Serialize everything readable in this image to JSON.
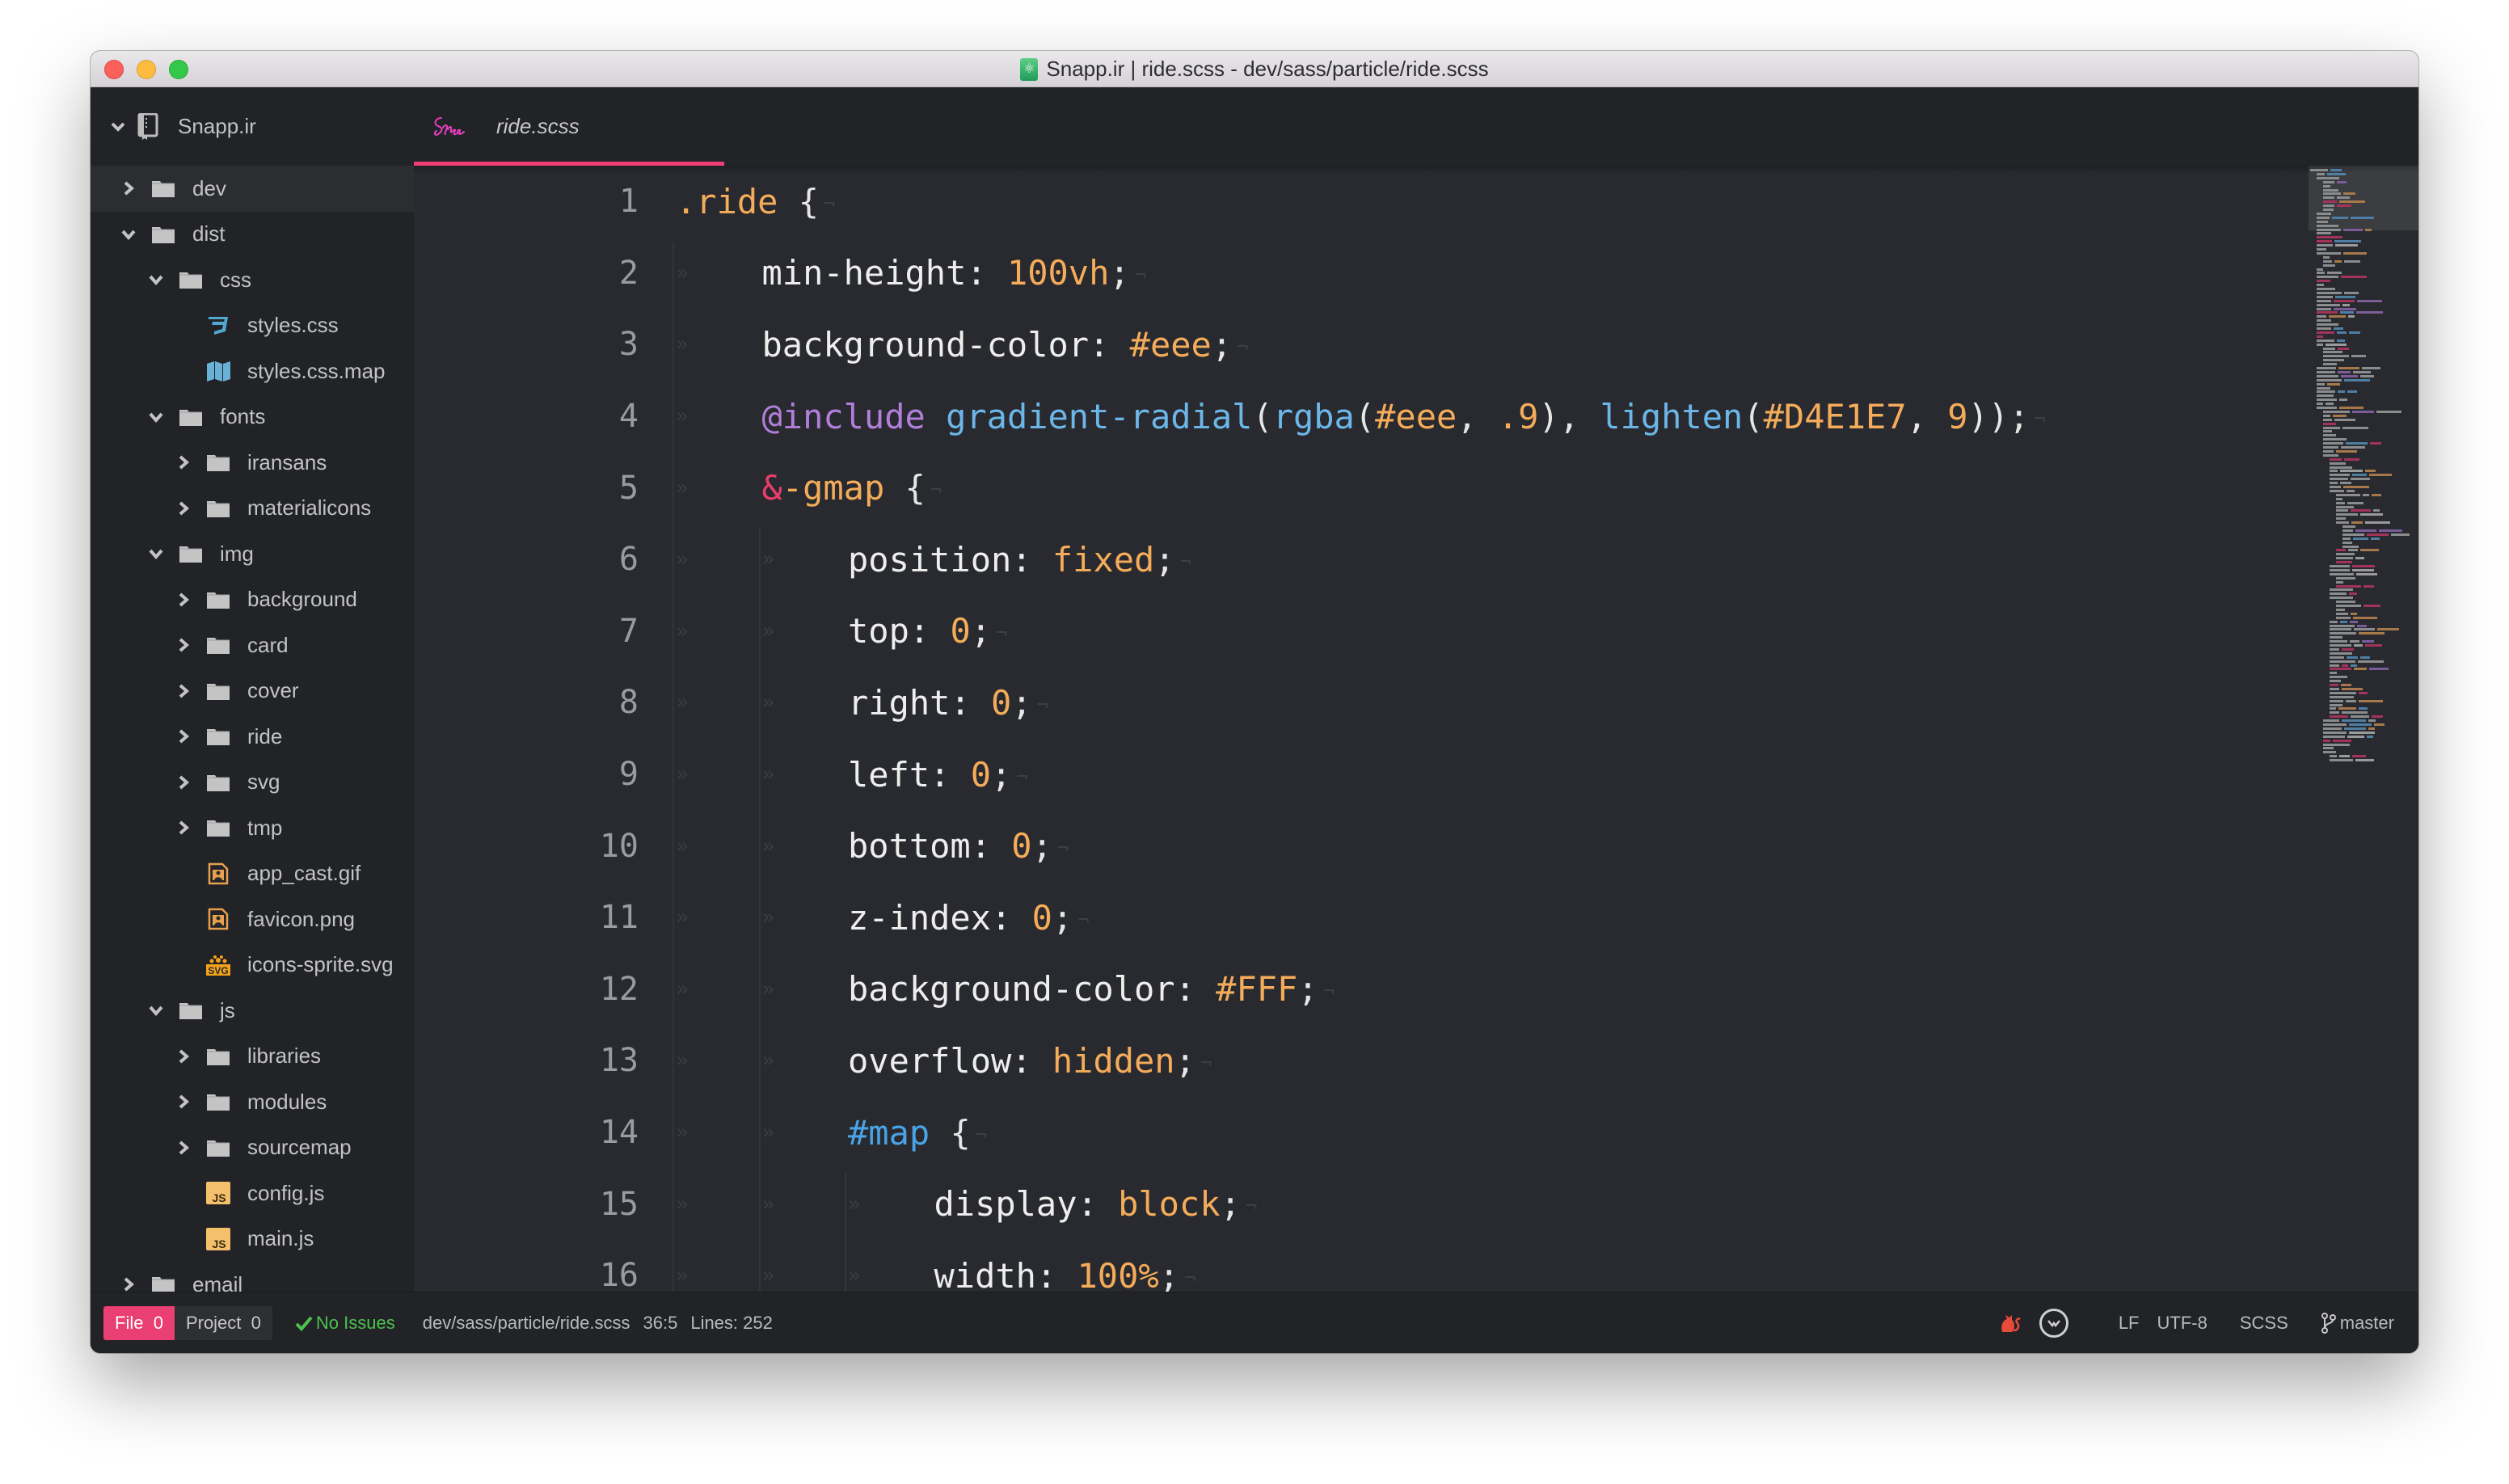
{
  "window": {
    "title": "Snapp.ir | ride.scss - dev/sass/particle/ride.scss"
  },
  "sidebar": {
    "project_name": "Snapp.ir",
    "tree": [
      {
        "label": "dev",
        "type": "folder",
        "depth": 0,
        "expanded": false,
        "selected": true
      },
      {
        "label": "dist",
        "type": "folder",
        "depth": 0,
        "expanded": true
      },
      {
        "label": "css",
        "type": "folder",
        "depth": 1,
        "expanded": true
      },
      {
        "label": "styles.css",
        "type": "file",
        "icon": "css3-icon",
        "depth": 2
      },
      {
        "label": "styles.css.map",
        "type": "file",
        "icon": "map-icon",
        "depth": 2
      },
      {
        "label": "fonts",
        "type": "folder",
        "depth": 1,
        "expanded": true
      },
      {
        "label": "iransans",
        "type": "folder",
        "depth": 2,
        "expanded": false
      },
      {
        "label": "materialicons",
        "type": "folder",
        "depth": 2,
        "expanded": false
      },
      {
        "label": "img",
        "type": "folder",
        "depth": 1,
        "expanded": true
      },
      {
        "label": "background",
        "type": "folder",
        "depth": 2,
        "expanded": false
      },
      {
        "label": "card",
        "type": "folder",
        "depth": 2,
        "expanded": false
      },
      {
        "label": "cover",
        "type": "folder",
        "depth": 2,
        "expanded": false
      },
      {
        "label": "ride",
        "type": "folder",
        "depth": 2,
        "expanded": false
      },
      {
        "label": "svg",
        "type": "folder",
        "depth": 2,
        "expanded": false
      },
      {
        "label": "tmp",
        "type": "folder",
        "depth": 2,
        "expanded": false
      },
      {
        "label": "app_cast.gif",
        "type": "file",
        "icon": "image-icon",
        "depth": 2
      },
      {
        "label": "favicon.png",
        "type": "file",
        "icon": "image-icon",
        "depth": 2
      },
      {
        "label": "icons-sprite.svg",
        "type": "file",
        "icon": "svg-icon",
        "depth": 2
      },
      {
        "label": "js",
        "type": "folder",
        "depth": 1,
        "expanded": true
      },
      {
        "label": "libraries",
        "type": "folder",
        "depth": 2,
        "expanded": false
      },
      {
        "label": "modules",
        "type": "folder",
        "depth": 2,
        "expanded": false
      },
      {
        "label": "sourcemap",
        "type": "folder",
        "depth": 2,
        "expanded": false
      },
      {
        "label": "config.js",
        "type": "file",
        "icon": "js-icon",
        "depth": 2
      },
      {
        "label": "main.js",
        "type": "file",
        "icon": "js-icon",
        "depth": 2
      },
      {
        "label": "email",
        "type": "folder",
        "depth": 0,
        "expanded": false
      }
    ]
  },
  "tabs": [
    {
      "label": "ride.scss",
      "icon": "sass-icon",
      "active": true
    }
  ],
  "colors": {
    "accent": "#ee3f74",
    "selector": "#f5ac5a",
    "value": "#f5ac5a",
    "at_rule": "#b17fd9",
    "function": "#6cb6e8",
    "ampersand": "#ea3e6a",
    "id": "#4aa3e6",
    "ok": "#4cc24e"
  },
  "editor": {
    "lines": [
      {
        "n": "1",
        "indent": 0,
        "tokens": [
          [
            "sel",
            ".ride"
          ],
          [
            "punc",
            " {"
          ]
        ]
      },
      {
        "n": "2",
        "indent": 1,
        "tokens": [
          [
            "prop",
            "min-height: "
          ],
          [
            "val",
            "100vh"
          ],
          [
            "punc",
            ";"
          ]
        ]
      },
      {
        "n": "3",
        "indent": 1,
        "tokens": [
          [
            "prop",
            "background-color: "
          ],
          [
            "val",
            "#eee"
          ],
          [
            "punc",
            ";"
          ]
        ]
      },
      {
        "n": "4",
        "indent": 1,
        "tokens": [
          [
            "at",
            "@include"
          ],
          [
            "punc",
            " "
          ],
          [
            "fn",
            "gradient-radial"
          ],
          [
            "punc",
            "("
          ],
          [
            "fn",
            "rgba"
          ],
          [
            "punc",
            "("
          ],
          [
            "val",
            "#eee"
          ],
          [
            "punc",
            ", "
          ],
          [
            "val",
            ".9"
          ],
          [
            "punc",
            "), "
          ],
          [
            "fn",
            "lighten"
          ],
          [
            "punc",
            "("
          ],
          [
            "val",
            "#D4E1E7"
          ],
          [
            "punc",
            ", "
          ],
          [
            "val",
            "9"
          ],
          [
            "punc",
            "));"
          ]
        ]
      },
      {
        "n": "5",
        "indent": 1,
        "tokens": [
          [
            "amp",
            "&"
          ],
          [
            "sel",
            "-gmap"
          ],
          [
            "punc",
            " {"
          ]
        ]
      },
      {
        "n": "6",
        "indent": 2,
        "tokens": [
          [
            "prop",
            "position: "
          ],
          [
            "val",
            "fixed"
          ],
          [
            "punc",
            ";"
          ]
        ]
      },
      {
        "n": "7",
        "indent": 2,
        "tokens": [
          [
            "prop",
            "top: "
          ],
          [
            "val",
            "0"
          ],
          [
            "punc",
            ";"
          ]
        ]
      },
      {
        "n": "8",
        "indent": 2,
        "tokens": [
          [
            "prop",
            "right: "
          ],
          [
            "val",
            "0"
          ],
          [
            "punc",
            ";"
          ]
        ]
      },
      {
        "n": "9",
        "indent": 2,
        "tokens": [
          [
            "prop",
            "left: "
          ],
          [
            "val",
            "0"
          ],
          [
            "punc",
            ";"
          ]
        ]
      },
      {
        "n": "10",
        "indent": 2,
        "tokens": [
          [
            "prop",
            "bottom: "
          ],
          [
            "val",
            "0"
          ],
          [
            "punc",
            ";"
          ]
        ]
      },
      {
        "n": "11",
        "indent": 2,
        "tokens": [
          [
            "prop",
            "z-index: "
          ],
          [
            "val",
            "0"
          ],
          [
            "punc",
            ";"
          ]
        ]
      },
      {
        "n": "12",
        "indent": 2,
        "tokens": [
          [
            "prop",
            "background-color: "
          ],
          [
            "val",
            "#FFF"
          ],
          [
            "punc",
            ";"
          ]
        ]
      },
      {
        "n": "13",
        "indent": 2,
        "tokens": [
          [
            "prop",
            "overflow: "
          ],
          [
            "val",
            "hidden"
          ],
          [
            "punc",
            ";"
          ]
        ]
      },
      {
        "n": "14",
        "indent": 2,
        "tokens": [
          [
            "id",
            "#map"
          ],
          [
            "punc",
            " {"
          ]
        ]
      },
      {
        "n": "15",
        "indent": 3,
        "tokens": [
          [
            "prop",
            "display: "
          ],
          [
            "val",
            "block"
          ],
          [
            "punc",
            ";"
          ]
        ]
      },
      {
        "n": "16",
        "indent": 3,
        "tokens": [
          [
            "prop",
            "width: "
          ],
          [
            "val",
            "100%"
          ],
          [
            "punc",
            ";"
          ]
        ]
      }
    ],
    "eol_marker": "¬",
    "indent_marker": "»"
  },
  "statusbar": {
    "linter_file_label": "File",
    "linter_file_count": "0",
    "linter_project_label": "Project",
    "linter_project_count": "0",
    "no_issues": "No Issues",
    "file_path": "dev/sass/particle/ride.scss",
    "cursor_position": "36:5",
    "line_count": "Lines: 252",
    "line_ending": "LF",
    "encoding": "UTF-8",
    "grammar": "SCSS",
    "branch": "master"
  }
}
